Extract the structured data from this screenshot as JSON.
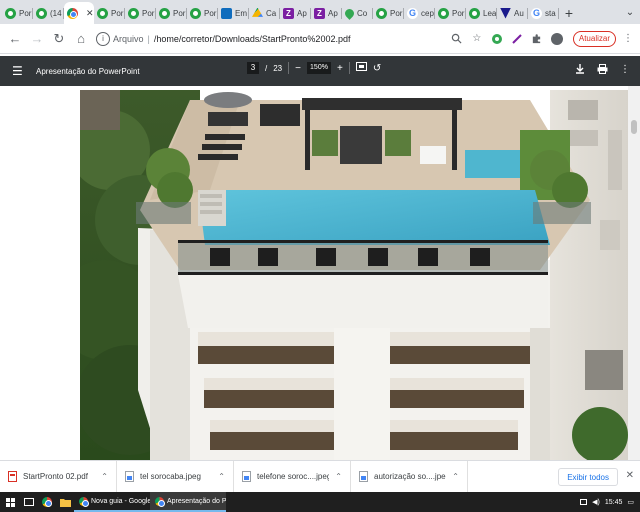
{
  "browser": {
    "tabs": [
      {
        "label": "Por",
        "icon": "whatsapp-icon"
      },
      {
        "label": "(14",
        "icon": "whatsapp-icon"
      },
      {
        "label": "",
        "icon": "chrome-icon",
        "active": true
      },
      {
        "label": "Por",
        "icon": "whatsapp-icon"
      },
      {
        "label": "Por",
        "icon": "whatsapp-icon"
      },
      {
        "label": "Por",
        "icon": "whatsapp-icon"
      },
      {
        "label": "Por",
        "icon": "whatsapp-icon"
      },
      {
        "label": "Em",
        "icon": "outlook-icon"
      },
      {
        "label": "Ca",
        "icon": "drive-icon"
      },
      {
        "label": "Ap",
        "icon": "z-icon"
      },
      {
        "label": "Ap",
        "icon": "z-icon"
      },
      {
        "label": "Co",
        "icon": "maps-icon"
      },
      {
        "label": "Por",
        "icon": "whatsapp-icon"
      },
      {
        "label": "cep",
        "icon": "google-icon"
      },
      {
        "label": "Por",
        "icon": "whatsapp-icon"
      },
      {
        "label": "Lea",
        "icon": "whatsapp-icon"
      },
      {
        "label": "Au",
        "icon": "shield-icon"
      },
      {
        "label": "sta",
        "icon": "google-icon"
      }
    ],
    "new_tab": "+",
    "address": {
      "scheme_label": "Arquivo",
      "url": "/home/corretor/Downloads/StartPronto%2002.pdf"
    },
    "update_button": "Atualizar"
  },
  "pdf_viewer": {
    "title": "Apresentação do PowerPoint",
    "page_current": "3",
    "page_separator": "/",
    "page_total": "23",
    "zoom": "150%",
    "zoom_out": "−",
    "zoom_in": "+"
  },
  "downloads": {
    "items": [
      {
        "name": "StartPronto 02.pdf",
        "type": "pdf"
      },
      {
        "name": "tel sorocaba.jpeg",
        "type": "image"
      },
      {
        "name": "telefone soroc....jpeg",
        "type": "image"
      },
      {
        "name": "autorização so....jpeg",
        "type": "image"
      }
    ],
    "show_all": "Exibir todos"
  },
  "taskbar": {
    "tasks": [
      {
        "label": "Nova guia - Google C...",
        "active": false
      },
      {
        "label": "Apresentação do Pow...",
        "active": true
      }
    ],
    "clock": "15:45"
  },
  "colors": {
    "pdf_toolbar": "#323639",
    "pool_water": "#4fb6cf",
    "building_wall": "#ecebe6"
  }
}
